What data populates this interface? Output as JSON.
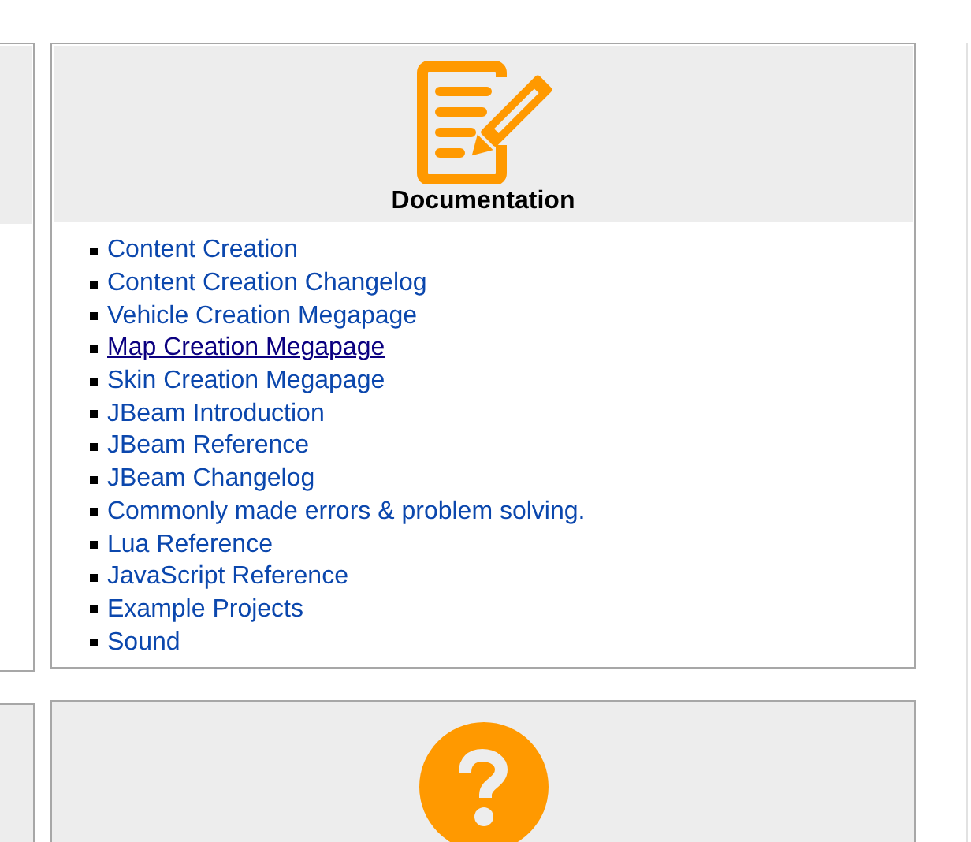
{
  "documentation_card": {
    "title": "Documentation",
    "links": [
      {
        "label": "Content Creation",
        "hovered": false
      },
      {
        "label": "Content Creation Changelog",
        "hovered": false
      },
      {
        "label": "Vehicle Creation Megapage",
        "hovered": false
      },
      {
        "label": "Map Creation Megapage",
        "hovered": true
      },
      {
        "label": "Skin Creation Megapage",
        "hovered": false
      },
      {
        "label": "JBeam Introduction",
        "hovered": false
      },
      {
        "label": "JBeam Reference",
        "hovered": false
      },
      {
        "label": "JBeam Changelog",
        "hovered": false
      },
      {
        "label": "Commonly made errors & problem solving.",
        "hovered": false
      },
      {
        "label": "Lua Reference",
        "hovered": false
      },
      {
        "label": "JavaScript Reference",
        "hovered": false
      },
      {
        "label": "Example Projects",
        "hovered": false
      },
      {
        "label": "Sound",
        "hovered": false
      }
    ]
  }
}
